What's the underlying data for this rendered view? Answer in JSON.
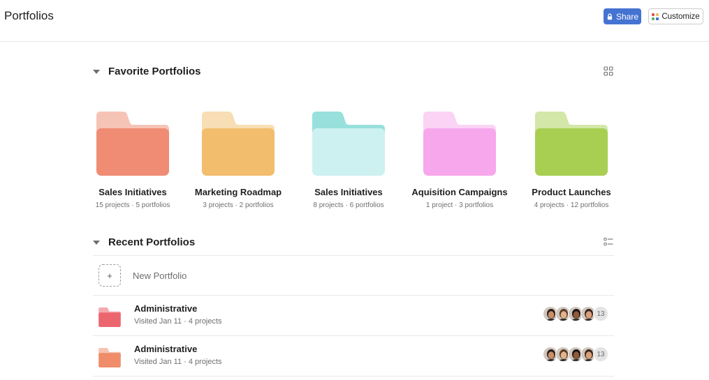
{
  "header": {
    "title": "Portfolios",
    "share_label": "Share",
    "customize_label": "Customize",
    "accent": "#4573d2"
  },
  "favorites": {
    "title": "Favorite Portfolios",
    "view_icon": "grid-view-icon",
    "items": [
      {
        "name": "Sales Initiatives",
        "meta": "15 projects · 5 portfolios",
        "color": "#ef8c73",
        "tab": "#f6c4b6"
      },
      {
        "name": "Marketing Roadmap",
        "meta": "3 projects · 2 portfolios",
        "color": "#f2bd6c",
        "tab": "#f8deb4"
      },
      {
        "name": "Sales Initiatives",
        "meta": "8 projects · 6 portfolios",
        "color": "#cdf1f0",
        "tab": "#97e0dc"
      },
      {
        "name": "Aquisition Campaigns",
        "meta": "1 project · 3 portfolios",
        "color": "#f7a7ec",
        "tab": "#fbd3f5"
      },
      {
        "name": "Product Launches",
        "meta": "4 projects · 12 portfolios",
        "color": "#a8cf52",
        "tab": "#d3e7a8"
      }
    ]
  },
  "recent": {
    "title": "Recent Portfolios",
    "view_icon": "list-view-icon",
    "new_label": "New Portfolio",
    "items": [
      {
        "name": "Administrative",
        "meta": "Visited Jan 11 · 4 projects",
        "color": "#ec6670",
        "tab": "#f4aab0",
        "member_count": "13"
      },
      {
        "name": "Administrative",
        "meta": "Visited Jan 11 · 4 projects",
        "color": "#ef8c6a",
        "tab": "#f6c4b0",
        "member_count": "13"
      }
    ]
  }
}
